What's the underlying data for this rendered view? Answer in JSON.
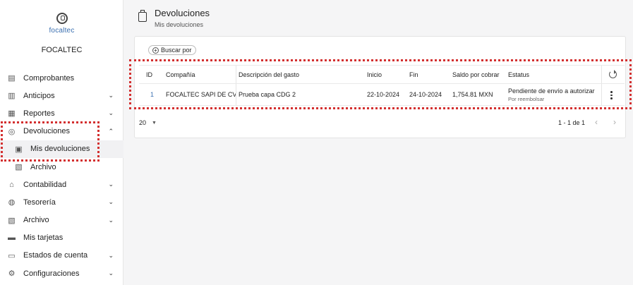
{
  "brand": {
    "logo_text": "focaltec",
    "company": "FOCALTEC"
  },
  "sidebar": {
    "items": [
      {
        "label": "Comprobantes",
        "icon": "receipt-icon",
        "glyph": "▤",
        "chevron": ""
      },
      {
        "label": "Anticipos",
        "icon": "document-icon",
        "glyph": "▥",
        "chevron": "⌄"
      },
      {
        "label": "Reportes",
        "icon": "report-icon",
        "glyph": "▦",
        "chevron": "⌄"
      },
      {
        "label": "Devoluciones",
        "icon": "returns-icon",
        "glyph": "◎",
        "chevron": "⌃"
      },
      {
        "label": "Mis devoluciones",
        "icon": "clipboard-icon",
        "glyph": "▣",
        "chevron": ""
      },
      {
        "label": "Archivo",
        "icon": "archive-icon",
        "glyph": "▧",
        "chevron": ""
      },
      {
        "label": "Contabilidad",
        "icon": "bank-icon",
        "glyph": "⌂",
        "chevron": "⌄"
      },
      {
        "label": "Tesorería",
        "icon": "piggy-bank-icon",
        "glyph": "◍",
        "chevron": "⌄"
      },
      {
        "label": "Archivo",
        "icon": "archive-icon",
        "glyph": "▧",
        "chevron": "⌄"
      },
      {
        "label": "Mis tarjetas",
        "icon": "card-icon",
        "glyph": "▬",
        "chevron": ""
      },
      {
        "label": "Estados de cuenta",
        "icon": "statement-icon",
        "glyph": "▭",
        "chevron": "⌄"
      },
      {
        "label": "Configuraciones",
        "icon": "gear-icon",
        "glyph": "⚙",
        "chevron": "⌄"
      }
    ]
  },
  "header": {
    "title": "Devoluciones",
    "subtitle": "Mis devoluciones"
  },
  "search": {
    "label": "Buscar por"
  },
  "table": {
    "columns": [
      "ID",
      "Compañía",
      "Descripción del gasto",
      "Inicio",
      "Fin",
      "Saldo por cobrar",
      "Estatus"
    ],
    "rows": [
      {
        "id": "1",
        "company": "FOCALTEC SAPI DE CV",
        "description": "Prueba capa CDG 2",
        "start": "22-10-2024",
        "end": "24-10-2024",
        "balance": "1,754.81 MXN",
        "status": "Pendiente de envío a autorizar",
        "status_sub": "Por reembolsar"
      }
    ]
  },
  "pagination": {
    "page_size": "20",
    "range": "1 - 1 de 1",
    "prev": "‹",
    "next": "›"
  }
}
